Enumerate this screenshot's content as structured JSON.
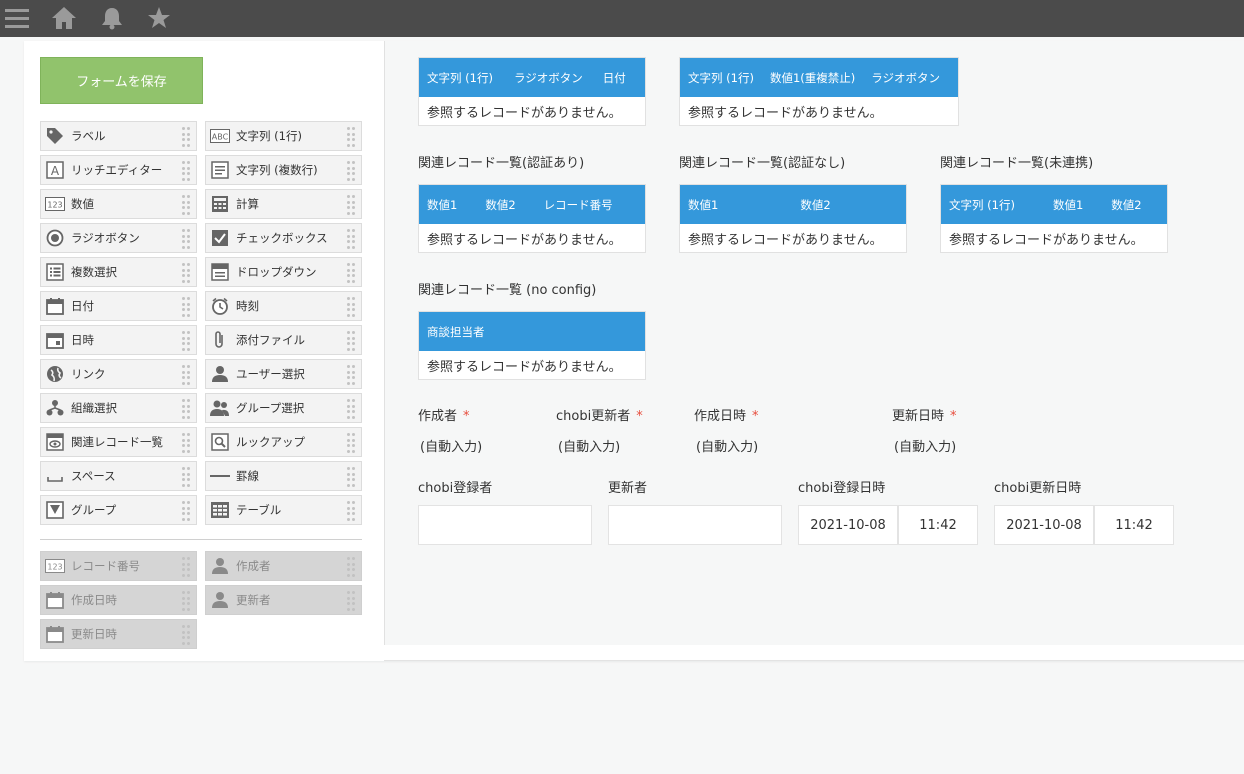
{
  "topbar": {
    "icons": [
      "menu-icon",
      "home-icon",
      "bell-icon",
      "star-icon"
    ]
  },
  "sidebar": {
    "save_label": "フォームを保存",
    "palette": [
      {
        "label": "ラベル",
        "icon": "tag-icon"
      },
      {
        "label": "文字列 (1行)",
        "icon": "abc-icon"
      },
      {
        "label": "リッチエディター",
        "icon": "rich-text-icon"
      },
      {
        "label": "文字列 (複数行)",
        "icon": "multiline-text-icon"
      },
      {
        "label": "数値",
        "icon": "number-icon"
      },
      {
        "label": "計算",
        "icon": "calculator-icon"
      },
      {
        "label": "ラジオボタン",
        "icon": "radio-icon"
      },
      {
        "label": "チェックボックス",
        "icon": "checkbox-icon"
      },
      {
        "label": "複数選択",
        "icon": "multi-select-icon"
      },
      {
        "label": "ドロップダウン",
        "icon": "dropdown-icon"
      },
      {
        "label": "日付",
        "icon": "calendar-icon"
      },
      {
        "label": "時刻",
        "icon": "clock-icon"
      },
      {
        "label": "日時",
        "icon": "datetime-icon"
      },
      {
        "label": "添付ファイル",
        "icon": "paperclip-icon"
      },
      {
        "label": "リンク",
        "icon": "globe-icon"
      },
      {
        "label": "ユーザー選択",
        "icon": "user-icon"
      },
      {
        "label": "組織選択",
        "icon": "org-icon"
      },
      {
        "label": "グループ選択",
        "icon": "group-icon"
      },
      {
        "label": "関連レコード一覧",
        "icon": "related-records-icon"
      },
      {
        "label": "ルックアップ",
        "icon": "lookup-icon"
      },
      {
        "label": "スペース",
        "icon": "space-icon"
      },
      {
        "label": "罫線",
        "icon": "line-icon"
      },
      {
        "label": "グループ",
        "icon": "group-field-icon"
      },
      {
        "label": "テーブル",
        "icon": "table-icon"
      }
    ],
    "system_fields": [
      {
        "label": "レコード番号",
        "icon": "number-icon"
      },
      {
        "label": "作成者",
        "icon": "user-icon"
      },
      {
        "label": "作成日時",
        "icon": "calendar-icon"
      },
      {
        "label": "更新者",
        "icon": "user-icon"
      },
      {
        "label": "更新日時",
        "icon": "calendar-icon"
      }
    ]
  },
  "canvas": {
    "empty_text": "参照するレコードがありません。",
    "top_tables": [
      {
        "columns": [
          "文字列 (1行)",
          "ラジオボタン",
          "日付"
        ]
      },
      {
        "columns": [
          "文字列 (1行)",
          "数値1(重複禁止)",
          "ラジオボタン"
        ]
      }
    ],
    "related_lists": [
      {
        "title": "関連レコード一覧(認証あり)",
        "columns": [
          "数値1",
          "数値2",
          "レコード番号"
        ]
      },
      {
        "title": "関連レコード一覧(認証なし)",
        "columns": [
          "数値1",
          "数値2"
        ]
      },
      {
        "title": "関連レコード一覧(未連携)",
        "columns": [
          "文字列 (1行)",
          "数値1",
          "数値2"
        ]
      },
      {
        "title": "関連レコード一覧 (no config)",
        "columns": [
          "商談担当者"
        ]
      }
    ],
    "auto_fields": [
      {
        "label": "作成者",
        "value": "(自動入力)"
      },
      {
        "label": "chobi更新者",
        "value": "(自動入力)"
      },
      {
        "label": "作成日時",
        "value": "(自動入力)"
      },
      {
        "label": "更新日時",
        "value": "(自動入力)"
      }
    ],
    "input_fields": [
      {
        "label": "chobi登録者"
      },
      {
        "label": "更新者"
      },
      {
        "label": "chobi登録日時",
        "date": "2021-10-08",
        "time": "11:42"
      },
      {
        "label": "chobi更新日時",
        "date": "2021-10-08",
        "time": "11:42"
      }
    ],
    "required_mark": "*",
    "colors": {
      "header_blue": "#3498db",
      "save_green": "#91c36c",
      "required_red": "#e74c3c"
    }
  }
}
